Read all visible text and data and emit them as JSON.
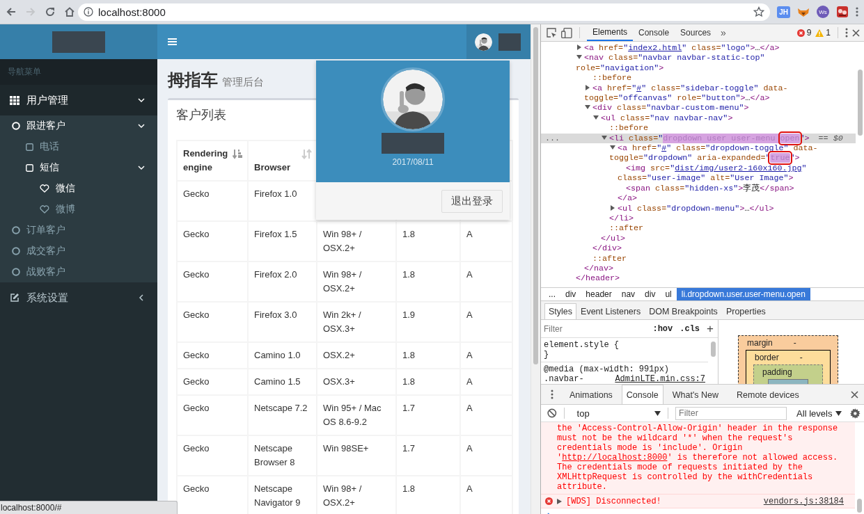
{
  "browser": {
    "back_enabled": true,
    "forward_enabled": false,
    "url": "localhost:8000",
    "extensions": [
      {
        "kind": "badge",
        "label": "JH"
      },
      {
        "kind": "fox"
      },
      {
        "kind": "round",
        "label": "Ws"
      },
      {
        "kind": "puzzle"
      }
    ]
  },
  "sidebar": {
    "header": "导航菜单",
    "menu": [
      {
        "label": "用户管理",
        "kind": "users",
        "active": true,
        "expanded": true,
        "children": [
          {
            "label": "跟进客户",
            "active": true,
            "expanded": true,
            "children": [
              {
                "label": "电话",
                "active": false
              },
              {
                "label": "短信",
                "active": true,
                "expanded": true,
                "children": [
                  {
                    "label": "微信",
                    "active": true
                  },
                  {
                    "label": "微博",
                    "active": false
                  }
                ]
              }
            ]
          },
          {
            "label": "订单客户",
            "active": false
          },
          {
            "label": "成交客户",
            "active": false
          },
          {
            "label": "战败客户",
            "active": false
          }
        ]
      },
      {
        "label": "系统设置",
        "kind": "settings",
        "active": false,
        "expanded": false
      }
    ]
  },
  "page_title": {
    "title": "拇指车",
    "subtitle": "管理后台"
  },
  "box": {
    "title": "客户列表",
    "table": {
      "columns": [
        {
          "label": "Rendering engine",
          "sorted": true
        },
        {
          "label": "Browser",
          "sorted": false
        }
      ],
      "rows": [
        [
          "Gecko",
          "Firefox 1.0"
        ],
        [
          "Gecko",
          "Firefox 1.5",
          "Win 98+ / OSX.2+",
          "1.8",
          "A"
        ],
        [
          "Gecko",
          "Firefox 2.0",
          "Win 98+ / OSX.2+",
          "1.8",
          "A"
        ],
        [
          "Gecko",
          "Firefox 3.0",
          "Win 2k+ / OSX.3+",
          "1.9",
          "A"
        ],
        [
          "Gecko",
          "Camino 1.0",
          "OSX.2+",
          "1.8",
          "A"
        ],
        [
          "Gecko",
          "Camino 1.5",
          "OSX.3+",
          "1.8",
          "A"
        ],
        [
          "Gecko",
          "Netscape 7.2",
          "Win 95+ / Mac OS 8.6-9.2",
          "1.7",
          "A"
        ],
        [
          "Gecko",
          "Netscape Browser 8",
          "Win 98SE+",
          "1.7",
          "A"
        ],
        [
          "Gecko",
          "Netscape Navigator 9",
          "Win 98+ / OSX.2+",
          "1.8",
          "A"
        ]
      ]
    }
  },
  "user_dropdown": {
    "date": "2017/08/11",
    "logout": "退出登录"
  },
  "status_bar": "localhost:8000/#",
  "devtools": {
    "panel_tabs": [
      {
        "label": "Elements",
        "selected": true
      },
      {
        "label": "Console",
        "selected": false
      },
      {
        "label": "Sources",
        "selected": false
      }
    ],
    "more_tabs": "»",
    "error_count": "9",
    "warning_count": "1",
    "dom_tree": {
      "close": "</header>",
      "children": [
        {
          "expanded": false,
          "parts": [
            {
              "kind": "tag",
              "text": "<a"
            },
            {
              "kind": "attr",
              "text": " href="
            },
            {
              "kind": "value",
              "text": "\""
            },
            {
              "kind": "link",
              "text": "index2.html"
            },
            {
              "kind": "value",
              "text": "\""
            },
            {
              "kind": "attr",
              "text": " class="
            },
            {
              "kind": "value",
              "text": "\"logo\""
            },
            {
              "kind": "tag",
              "text": ">"
            },
            {
              "kind": "text",
              "text": "…"
            },
            {
              "kind": "tag",
              "text": "</a>"
            }
          ]
        },
        {
          "expanded": true,
          "close": "</nav>",
          "parts": [
            {
              "kind": "tag",
              "text": "<nav"
            },
            {
              "kind": "attr",
              "text": " class="
            },
            {
              "kind": "value",
              "text": "\"navbar navbar-static-top\""
            },
            {
              "kind": "attr",
              "text": " role="
            },
            {
              "kind": "value",
              "text": "\"navigation\""
            },
            {
              "kind": "tag",
              "text": ">"
            }
          ],
          "children": [
            {
              "parts": [
                {
                  "kind": "pseudo",
                  "text": "::before"
                }
              ]
            },
            {
              "expanded": false,
              "parts": [
                {
                  "kind": "tag",
                  "text": "<a"
                },
                {
                  "kind": "attr",
                  "text": " href="
                },
                {
                  "kind": "value",
                  "text": "\""
                },
                {
                  "kind": "link",
                  "text": "#"
                },
                {
                  "kind": "value",
                  "text": "\""
                },
                {
                  "kind": "attr",
                  "text": " class="
                },
                {
                  "kind": "value",
                  "text": "\"sidebar-toggle\""
                },
                {
                  "kind": "attr",
                  "text": " data-toggle="
                },
                {
                  "kind": "value",
                  "text": "\"offcanvas\""
                },
                {
                  "kind": "attr",
                  "text": " role="
                },
                {
                  "kind": "value",
                  "text": "\"button\""
                },
                {
                  "kind": "tag",
                  "text": ">"
                },
                {
                  "kind": "text",
                  "text": "…"
                },
                {
                  "kind": "tag",
                  "text": "</a>"
                }
              ]
            },
            {
              "expanded": true,
              "close": "</div>",
              "parts": [
                {
                  "kind": "tag",
                  "text": "<div"
                },
                {
                  "kind": "attr",
                  "text": " class="
                },
                {
                  "kind": "value",
                  "text": "\"navbar-custom-menu\""
                },
                {
                  "kind": "tag",
                  "text": ">"
                }
              ],
              "children": [
                {
                  "expanded": true,
                  "close": "</ul>",
                  "parts": [
                    {
                      "kind": "tag",
                      "text": "<ul"
                    },
                    {
                      "kind": "attr",
                      "text": " class="
                    },
                    {
                      "kind": "value",
                      "text": "\"nav navbar-nav\""
                    },
                    {
                      "kind": "tag",
                      "text": ">"
                    }
                  ],
                  "children": [
                    {
                      "parts": [
                        {
                          "kind": "pseudo",
                          "text": "::before"
                        }
                      ]
                    },
                    {
                      "expanded": true,
                      "selected": true,
                      "gutter": "...",
                      "suffix": "== $0",
                      "close": "</li>",
                      "parts": [
                        {
                          "kind": "tag",
                          "text": "<li"
                        },
                        {
                          "kind": "attr",
                          "text": " class="
                        },
                        {
                          "kind": "value",
                          "text": "\""
                        },
                        {
                          "kind": "highlight",
                          "text": "dropdown user user-menu "
                        },
                        {
                          "kind": "boxed",
                          "text": "open"
                        },
                        {
                          "kind": "value",
                          "text": "\""
                        },
                        {
                          "kind": "tag",
                          "text": ">"
                        }
                      ],
                      "children": [
                        {
                          "expanded": true,
                          "close": "</a>",
                          "parts": [
                            {
                              "kind": "tag",
                              "text": "<a"
                            },
                            {
                              "kind": "attr",
                              "text": " href="
                            },
                            {
                              "kind": "value",
                              "text": "\""
                            },
                            {
                              "kind": "link",
                              "text": "#"
                            },
                            {
                              "kind": "value",
                              "text": "\""
                            },
                            {
                              "kind": "attr",
                              "text": " class="
                            },
                            {
                              "kind": "value",
                              "text": "\"dropdown-toggle\""
                            },
                            {
                              "kind": "attr",
                              "text": " data-toggle="
                            },
                            {
                              "kind": "value",
                              "text": "\"dropdown\""
                            },
                            {
                              "kind": "attr",
                              "text": " aria-expanded="
                            },
                            {
                              "kind": "value",
                              "text": "\""
                            },
                            {
                              "kind": "boxed",
                              "text": "true"
                            },
                            {
                              "kind": "value",
                              "text": "\""
                            },
                            {
                              "kind": "tag",
                              "text": ">"
                            }
                          ],
                          "children": [
                            {
                              "parts": [
                                {
                                  "kind": "tag",
                                  "text": "<img"
                                },
                                {
                                  "kind": "attr",
                                  "text": " src="
                                },
                                {
                                  "kind": "value",
                                  "text": "\""
                                },
                                {
                                  "kind": "link",
                                  "text": "dist/img/user2-160x160.jpg"
                                },
                                {
                                  "kind": "value",
                                  "text": "\""
                                },
                                {
                                  "kind": "attr",
                                  "text": " class="
                                },
                                {
                                  "kind": "value",
                                  "text": "\"user-image\""
                                },
                                {
                                  "kind": "attr",
                                  "text": " alt="
                                },
                                {
                                  "kind": "value",
                                  "text": "\"User Image\""
                                },
                                {
                                  "kind": "tag",
                                  "text": ">"
                                }
                              ]
                            },
                            {
                              "parts": [
                                {
                                  "kind": "tag",
                                  "text": "<span"
                                },
                                {
                                  "kind": "attr",
                                  "text": " class="
                                },
                                {
                                  "kind": "value",
                                  "text": "\"hidden-xs\""
                                },
                                {
                                  "kind": "tag",
                                  "text": ">"
                                },
                                {
                                  "kind": "text",
                                  "text": "李茂"
                                },
                                {
                                  "kind": "tag",
                                  "text": "</span>"
                                }
                              ]
                            }
                          ]
                        },
                        {
                          "expanded": false,
                          "parts": [
                            {
                              "kind": "tag",
                              "text": "<ul"
                            },
                            {
                              "kind": "attr",
                              "text": " class="
                            },
                            {
                              "kind": "value",
                              "text": "\"dropdown-menu\""
                            },
                            {
                              "kind": "tag",
                              "text": ">"
                            },
                            {
                              "kind": "text",
                              "text": "…"
                            },
                            {
                              "kind": "tag",
                              "text": "</ul>"
                            }
                          ]
                        }
                      ]
                    },
                    {
                      "parts": [
                        {
                          "kind": "pseudo",
                          "text": "::after"
                        }
                      ]
                    }
                  ]
                }
              ]
            },
            {
              "parts": [
                {
                  "kind": "pseudo",
                  "text": "::after"
                }
              ]
            }
          ]
        }
      ]
    },
    "breadcrumbs": [
      {
        "label": "...",
        "selected": false
      },
      {
        "label": "div",
        "selected": false
      },
      {
        "label": "header",
        "selected": false
      },
      {
        "label": "nav",
        "selected": false
      },
      {
        "label": "div",
        "selected": false
      },
      {
        "label": "ul",
        "selected": false
      },
      {
        "label": "li.dropdown.user.user-menu.open",
        "selected": true
      }
    ],
    "styles_tabs": [
      {
        "label": "Styles",
        "selected": true
      },
      {
        "label": "Event Listeners",
        "selected": false
      },
      {
        "label": "DOM Breakpoints",
        "selected": false
      },
      {
        "label": "Properties",
        "selected": false
      }
    ],
    "styles_filter": {
      "placeholder": "Filter"
    },
    "hov": ":hov",
    "cls": ".cls",
    "add": "+",
    "style_rules": [
      {
        "lines": [
          "element.style {",
          "}"
        ]
      },
      {
        "lines": [
          "@media (max-width: 991px)",
          ".navbar-"
        ],
        "source": "AdminLTE.min.css:7"
      }
    ],
    "box_model": [
      {
        "label": "margin",
        "value": "-",
        "color": "#f9cc9d"
      },
      {
        "label": "border",
        "value": "-",
        "color": "#fddd9b"
      },
      {
        "label": "padding",
        "color": "#c3d08b"
      }
    ],
    "drawer_tabs": [
      {
        "label": "Animations",
        "selected": false
      },
      {
        "label": "Console",
        "selected": true
      },
      {
        "label": "What's New",
        "selected": false
      },
      {
        "label": "Remote devices",
        "selected": false
      }
    ],
    "console_context": "top",
    "console_filter": {
      "placeholder": "Filter"
    },
    "console_levels": "All levels",
    "messages": [
      {
        "kind": "continued",
        "text_before": "the 'Access-Control-Allow-Origin' header in the response must not be the wildcard '*' when the request's credentials mode is 'include'. Origin '",
        "link": "http://localhost:8000",
        "text_after": "' is therefore not allowed access. The credentials mode of requests initiated by the XMLHttpRequest is controlled by the withCredentials attribute."
      },
      {
        "kind": "error",
        "expandable": true,
        "text": "[WDS] Disconnected!",
        "source": "vendors.js:38184"
      }
    ]
  }
}
